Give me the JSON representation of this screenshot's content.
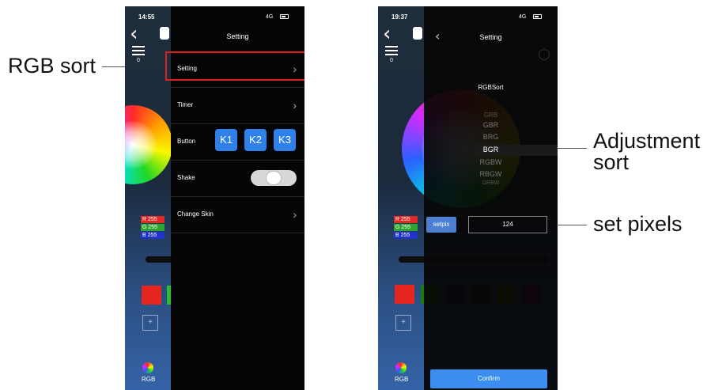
{
  "annotations": {
    "rgb_sort": "RGB sort",
    "adjustment_sort": [
      "Adjustment",
      "sort"
    ],
    "set_pixels": "set pixels"
  },
  "phone1": {
    "status_time": "14:55",
    "status_signal": "4G",
    "menu_count": "0",
    "rgb_values": [
      "R 255",
      "G 255",
      "B 255"
    ],
    "nav_label": "RGB",
    "panel_title": "Setting",
    "rows": {
      "setting": "Setting",
      "timer": "Timer",
      "button": "Button",
      "shake": "Shake",
      "change_skin": "Change Skin"
    },
    "buttons": [
      "K1",
      "K2",
      "K3"
    ],
    "shake_toggle_on": true,
    "swatch_colors": [
      "#e5251e",
      "#2ac02a"
    ]
  },
  "phone2": {
    "status_time": "19:37",
    "status_signal": "4G",
    "menu_count": "0",
    "rgb_values": [
      "R 255",
      "G 255",
      "B 255"
    ],
    "nav_label": "RGB",
    "panel_title": "Setting",
    "sort_title": "RGBSort",
    "sort_options": [
      "GRB",
      "GBR",
      "BRG",
      "BGR",
      "RGBW",
      "RBGW",
      "GRBW"
    ],
    "selected_sort": "BGR",
    "setpix_label": "setpix",
    "pixel_value": "124",
    "confirm_label": "Confirm",
    "swatch_colors": [
      "#e5251e",
      "#1a7a1a",
      "#101050",
      "#1a1a1a",
      "#6a6a00",
      "#5a0a4a"
    ]
  },
  "colors": {
    "accent_blue": "#2f80e8",
    "highlight_red": "#e02020"
  }
}
